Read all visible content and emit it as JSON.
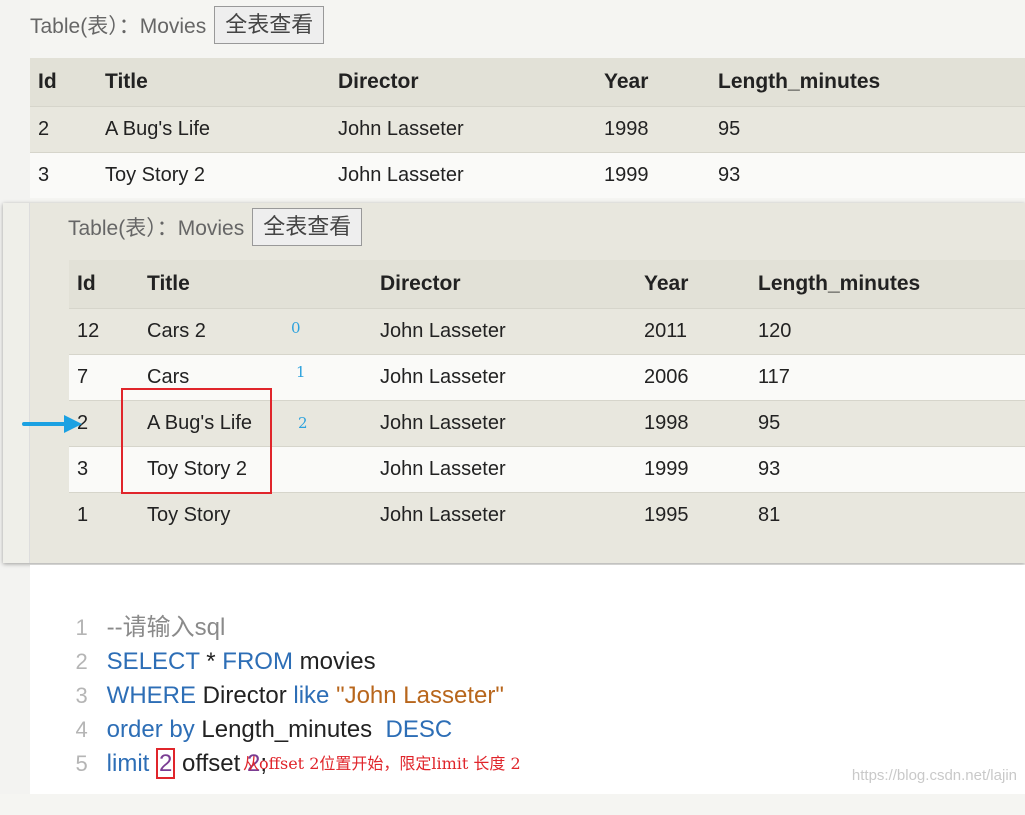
{
  "top_panel": {
    "heading": "Table(表）：Movies",
    "view_all_button": "全表查看",
    "columns": [
      "Id",
      "Title",
      "Director",
      "Year",
      "Length_minutes"
    ],
    "rows": [
      [
        "2",
        "A Bug's Life",
        "John Lasseter",
        "1998",
        "95"
      ],
      [
        "3",
        "Toy Story 2",
        "John Lasseter",
        "1999",
        "93"
      ]
    ]
  },
  "mid_panel": {
    "heading": "Table(表）：Movies",
    "view_all_button": "全表查看",
    "columns": [
      "Id",
      "Title",
      "Director",
      "Year",
      "Length_minutes"
    ],
    "rows": [
      [
        "12",
        "Cars 2",
        "John Lasseter",
        "2011",
        "120"
      ],
      [
        "7",
        "Cars",
        "John Lasseter",
        "2006",
        "117"
      ],
      [
        "2",
        "A Bug's Life",
        "John Lasseter",
        "1998",
        "95"
      ],
      [
        "3",
        "Toy Story 2",
        "John Lasseter",
        "1999",
        "93"
      ],
      [
        "1",
        "Toy Story",
        "John Lasseter",
        "1995",
        "81"
      ]
    ],
    "offset_markers": [
      "0",
      "1",
      "2"
    ],
    "arrow_color": "#1ba1e2",
    "highlight_color": "#e0252b"
  },
  "editor": {
    "line_numbers": [
      "1",
      "2",
      "3",
      "4",
      "5"
    ],
    "line1": {
      "comment": "--请输入sql"
    },
    "line2": {
      "kw1": "SELECT",
      "t1": " * ",
      "kw2": "FROM",
      "t2": " movies"
    },
    "line3": {
      "kw1": "WHERE",
      "t1": " Director ",
      "kw2": "like",
      "t2": " ",
      "str": "\"John Lasseter\""
    },
    "line4": {
      "kw1": "order by",
      "t1": " Length_minutes  ",
      "kw2": "DESC"
    },
    "line5": {
      "kw1": "limit",
      "num1": "2",
      "t1": " offset ",
      "num2": "2",
      "t2": ";"
    },
    "note": "从offset 2位置开始，限定limit 长度 2"
  },
  "watermark": "https://blog.csdn.net/lajin"
}
